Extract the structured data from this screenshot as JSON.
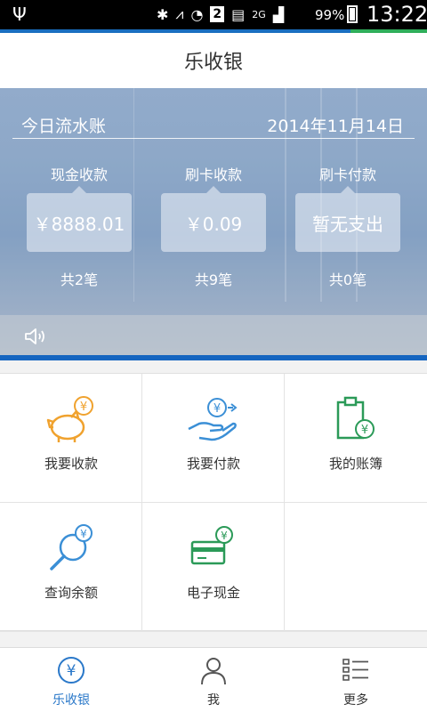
{
  "status_bar": {
    "battery": "99%",
    "time": "13:22",
    "sim_slot": "2",
    "network": "2G"
  },
  "app": {
    "title": "乐收银"
  },
  "summary": {
    "heading": "今日流水账",
    "date": "2014年11月14日",
    "columns": [
      {
        "label": "现金收款",
        "amount": "￥8888.01",
        "count": "共2笔"
      },
      {
        "label": "刷卡收款",
        "amount": "￥0.09",
        "count": "共9笔"
      },
      {
        "label": "刷卡付款",
        "amount": "暂无支出",
        "count": "共0笔"
      }
    ]
  },
  "menu": [
    {
      "label": "我要收款",
      "icon": "piggy-bank-icon"
    },
    {
      "label": "我要付款",
      "icon": "pay-hand-icon"
    },
    {
      "label": "我的账簿",
      "icon": "ledger-icon"
    },
    {
      "label": "查询余额",
      "icon": "balance-search-icon"
    },
    {
      "label": "电子现金",
      "icon": "ecash-card-icon"
    }
  ],
  "tabs": [
    {
      "label": "乐收银",
      "active": true
    },
    {
      "label": "我",
      "active": false
    },
    {
      "label": "更多",
      "active": false
    }
  ],
  "colors": {
    "accent": "#2a78c9",
    "orange": "#f0a22e",
    "blue": "#3b8fd6",
    "green": "#2b9a58",
    "hero_bar": "#1565c0"
  }
}
